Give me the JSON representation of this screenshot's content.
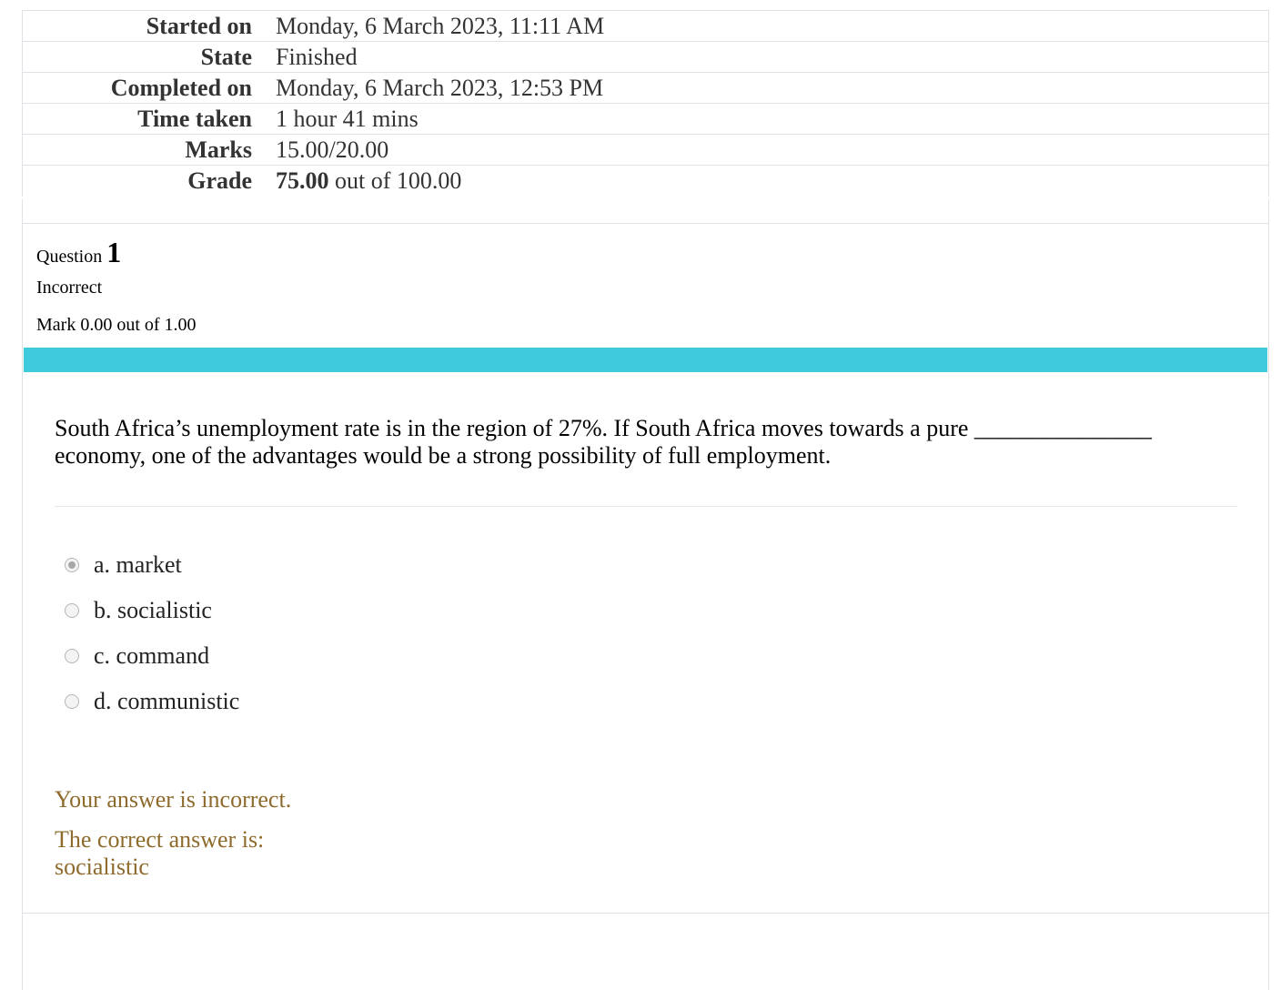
{
  "summary": [
    {
      "label": "Started on",
      "value": "Monday, 6 March 2023, 11:11 AM"
    },
    {
      "label": "State",
      "value": "Finished"
    },
    {
      "label": "Completed on",
      "value": "Monday, 6 March 2023, 12:53 PM"
    },
    {
      "label": "Time taken",
      "value": "1 hour 41 mins"
    },
    {
      "label": "Marks",
      "value": "15.00/20.00"
    },
    {
      "label": "Grade",
      "value_bold": "75.00",
      "value_rest": " out of 100.00"
    }
  ],
  "question": {
    "prefix": "Question ",
    "number": "1",
    "state": "Incorrect",
    "grade": "Mark 0.00 out of 1.00",
    "text": "South Africa’s unemployment rate is in the region of 27%. If South Africa moves towards a pure _______________ economy, one of the advantages would be a strong possibility of full employment.",
    "answers": [
      {
        "label": "a. market",
        "checked": true
      },
      {
        "label": "b. socialistic",
        "checked": false
      },
      {
        "label": "c. command",
        "checked": false
      },
      {
        "label": "d. communistic",
        "checked": false
      }
    ],
    "feedback_incorrect": "Your answer is incorrect.",
    "feedback_correct_intro": "The correct answer is:",
    "feedback_correct_answer": "socialistic"
  },
  "colors": {
    "accent_bar": "#3fcbdb",
    "feedback_text": "#8e6a2c",
    "border": "#dee2e6"
  }
}
